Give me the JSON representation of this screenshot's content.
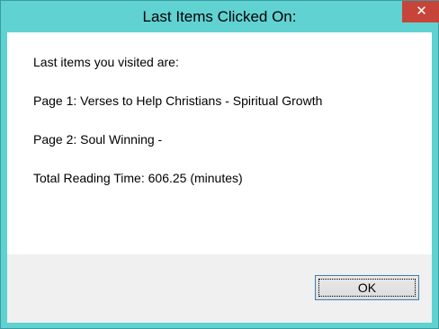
{
  "window": {
    "title": "Last Items Clicked On:",
    "close_glyph": "✕"
  },
  "content": {
    "intro": "Last items you visited are:",
    "page1": "Page 1: Verses to Help Christians - Spiritual Growth",
    "page2": "Page 2: Soul Winning -",
    "total_time": "Total Reading Time: 606.25 (minutes)"
  },
  "footer": {
    "ok_label": "OK"
  },
  "colors": {
    "titlebar": "#61d2d2",
    "close_button": "#c7443b",
    "footer_bg": "#f0f0f0",
    "button_focus_border": "#3c7fb1"
  }
}
